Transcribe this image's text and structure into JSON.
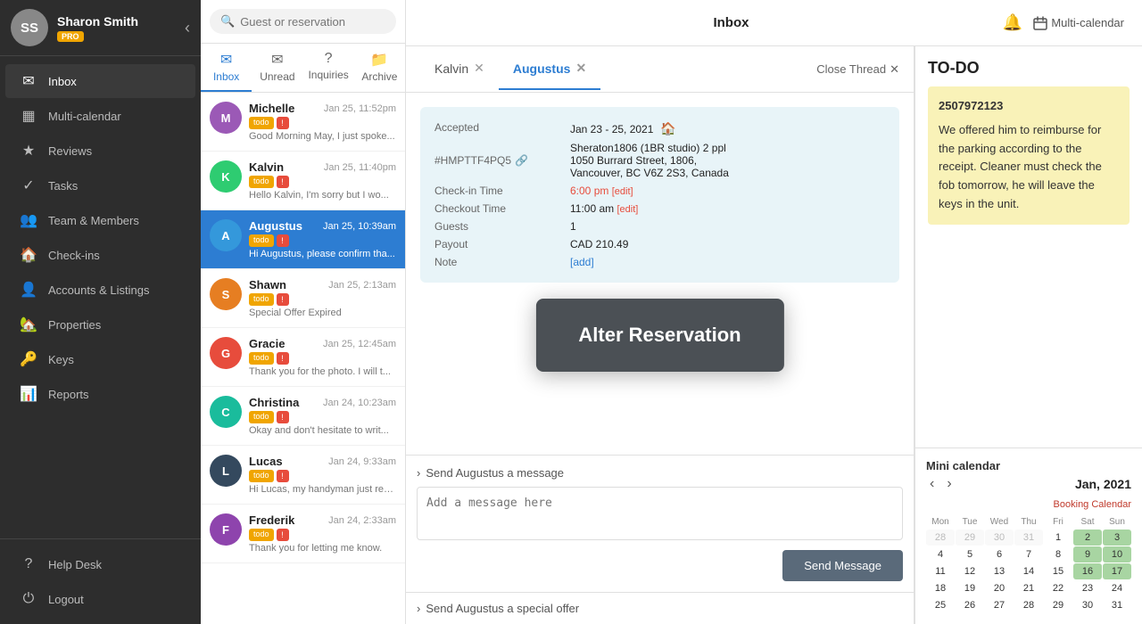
{
  "sidebar": {
    "username": "Sharon Smith",
    "pro_label": "PRO",
    "avatar_initials": "SS",
    "nav_items": [
      {
        "id": "inbox",
        "label": "Inbox",
        "icon": "✉",
        "active": true
      },
      {
        "id": "multi-calendar",
        "label": "Multi-calendar",
        "icon": "▦"
      },
      {
        "id": "reviews",
        "label": "Reviews",
        "icon": "★"
      },
      {
        "id": "tasks",
        "label": "Tasks",
        "icon": "✓"
      },
      {
        "id": "team-members",
        "label": "Team & Members",
        "icon": "👥"
      },
      {
        "id": "check-ins",
        "label": "Check-ins",
        "icon": "🏠"
      },
      {
        "id": "accounts-listings",
        "label": "Accounts & Listings",
        "icon": "👤"
      },
      {
        "id": "properties",
        "label": "Properties",
        "icon": "🏡"
      },
      {
        "id": "keys",
        "label": "Keys",
        "icon": "🔑"
      },
      {
        "id": "reports",
        "label": "Reports",
        "icon": "📊"
      }
    ],
    "footer_items": [
      {
        "id": "help-desk",
        "label": "Help Desk",
        "icon": "?"
      },
      {
        "id": "logout",
        "label": "Logout",
        "icon": "⏻"
      }
    ]
  },
  "search": {
    "placeholder": "Guest or reservation"
  },
  "msg_tabs": [
    {
      "id": "inbox",
      "label": "Inbox",
      "icon": "✉",
      "active": true
    },
    {
      "id": "unread",
      "label": "Unread",
      "icon": "✉"
    },
    {
      "id": "inquiries",
      "label": "Inquiries",
      "icon": "?"
    },
    {
      "id": "archive",
      "label": "Archive",
      "icon": "📁"
    }
  ],
  "messages": [
    {
      "id": "michelle",
      "initials": "M",
      "name": "Michelle",
      "date": "Jan 25, 11:52pm",
      "preview": "Good Morning May, I just spoke...",
      "todo": true,
      "flag": true,
      "color": "#9b59b6"
    },
    {
      "id": "kalvin",
      "initials": "K",
      "name": "Kalvin",
      "date": "Jan 25, 11:40pm",
      "preview": "Hello Kalvin, I'm sorry but I wo...",
      "todo": true,
      "flag": true,
      "color": "#2ecc71"
    },
    {
      "id": "augustus",
      "initials": "A",
      "name": "Augustus",
      "date": "Jan 25, 10:39am",
      "preview": "Hi Augustus, please confirm tha...",
      "todo": true,
      "flag": true,
      "active": true,
      "color": "#3498db"
    },
    {
      "id": "shawn",
      "initials": "S",
      "name": "Shawn",
      "date": "Jan 25, 2:13am",
      "preview": "Special Offer Expired",
      "todo": true,
      "flag": true,
      "color": "#e67e22"
    },
    {
      "id": "gracie",
      "initials": "G",
      "name": "Gracie",
      "date": "Jan 25, 12:45am",
      "preview": "Thank you for the photo. I will t...",
      "todo": true,
      "flag": true,
      "color": "#e74c3c"
    },
    {
      "id": "christina",
      "initials": "C",
      "name": "Christina",
      "date": "Jan 24, 10:23am",
      "preview": "Okay and don't hesitate to writ...",
      "todo": true,
      "flag": true,
      "color": "#1abc9c"
    },
    {
      "id": "lucas",
      "initials": "L",
      "name": "Lucas",
      "date": "Jan 24, 9:33am",
      "preview": "Hi Lucas, my handyman just rep...",
      "todo": true,
      "flag": true,
      "color": "#34495e"
    },
    {
      "id": "frederik",
      "initials": "F",
      "name": "Frederik",
      "date": "Jan 24, 2:33am",
      "preview": "Thank you for letting me know.",
      "todo": true,
      "flag": true,
      "color": "#8e44ad"
    }
  ],
  "thread": {
    "tabs": [
      {
        "id": "kalvin",
        "label": "Kalvin"
      },
      {
        "id": "augustus",
        "label": "Augustus",
        "active": true
      }
    ],
    "close_thread_label": "Close Thread",
    "reservation": {
      "status": "Accepted",
      "dates": "Jan 23 - 25, 2021",
      "property_code": "#HMPTTF4PQ5",
      "property_name": "Sheraton1806 (1BR studio) 2 ppl",
      "address": "1050 Burrard Street, 1806,",
      "city": "Vancouver, BC V6Z 2S3, Canada",
      "checkin_label": "Check-in Time",
      "checkin_value": "6:00 pm",
      "checkin_edit": "[edit]",
      "checkout_label": "Checkout Time",
      "checkout_value": "11:00 am",
      "checkout_edit": "[edit]",
      "guests_label": "Guests",
      "guests_value": "1",
      "payout_label": "Payout",
      "payout_value": "CAD 210.49",
      "note_label": "Note",
      "note_add": "[add]"
    },
    "send_msg": {
      "header": "Send Augustus a message",
      "placeholder": "Add a message here",
      "send_label": "Send Message"
    },
    "special_offer": {
      "label": "Send Augustus a special offer"
    },
    "alter_reservation_label": "Alter Reservation"
  },
  "right_panel": {
    "todo_heading": "TO-DO",
    "todo_phone": "2507972123",
    "todo_text": "We offered him to reimburse for the parking according to the receipt. Cleaner must check the fob tomorrow, he will leave the keys in the unit.",
    "mini_cal_heading": "Mini calendar",
    "booking_cal_link": "Booking Calendar",
    "cal_month": "Jan, 2021",
    "cal_headers": [
      "Mon",
      "Tue",
      "Wed",
      "Thu",
      "Fri",
      "Sat",
      "Sun"
    ],
    "cal_weeks": [
      [
        {
          "d": "28",
          "o": true
        },
        {
          "d": "29",
          "o": true
        },
        {
          "d": "30",
          "o": true
        },
        {
          "d": "31",
          "o": true
        },
        {
          "d": "1"
        },
        {
          "d": "2",
          "b": true
        },
        {
          "d": "3",
          "b": true
        }
      ],
      [
        {
          "d": "4"
        },
        {
          "d": "5"
        },
        {
          "d": "6"
        },
        {
          "d": "7"
        },
        {
          "d": "8"
        },
        {
          "d": "9",
          "b": true
        },
        {
          "d": "10",
          "b": true
        }
      ],
      [
        {
          "d": "11"
        },
        {
          "d": "12"
        },
        {
          "d": "13"
        },
        {
          "d": "14"
        },
        {
          "d": "15"
        },
        {
          "d": "16",
          "b": true
        },
        {
          "d": "17",
          "b": true
        }
      ],
      [
        {
          "d": "18"
        },
        {
          "d": "19"
        },
        {
          "d": "20"
        },
        {
          "d": "21"
        },
        {
          "d": "22"
        },
        {
          "d": "23"
        },
        {
          "d": "24"
        }
      ],
      [
        {
          "d": "25"
        },
        {
          "d": "26"
        },
        {
          "d": "27"
        },
        {
          "d": "28"
        },
        {
          "d": "29"
        },
        {
          "d": "30"
        },
        {
          "d": "31"
        }
      ]
    ]
  },
  "top_bar": {
    "title": "Inbox"
  }
}
